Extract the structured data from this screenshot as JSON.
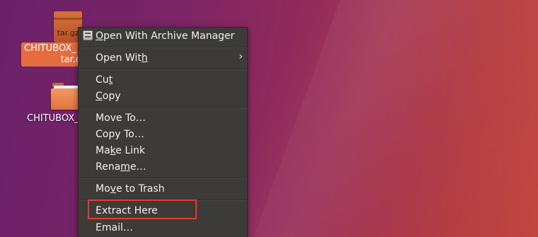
{
  "desktop": {
    "archive_icon": {
      "ext_label": "tar.gz",
      "label_line1": "CHITUBOX_",
      "label_line2": "tar.gz"
    },
    "folder_icon": {
      "label": "CHITUBOX_"
    }
  },
  "context_menu": {
    "items": [
      {
        "pre": "",
        "ul": "O",
        "post": "pen With Archive Manager"
      },
      {
        "pre": "Open Wit",
        "ul": "h",
        "post": ""
      },
      {
        "pre": "Cu",
        "ul": "t",
        "post": ""
      },
      {
        "pre": "",
        "ul": "C",
        "post": "opy"
      },
      {
        "pre": "Move To…",
        "ul": "",
        "post": ""
      },
      {
        "pre": "Copy To…",
        "ul": "",
        "post": ""
      },
      {
        "pre": "Ma",
        "ul": "k",
        "post": "e Link"
      },
      {
        "pre": "Rena",
        "ul": "m",
        "post": "e…"
      },
      {
        "pre": "Mo",
        "ul": "v",
        "post": "e to Trash"
      },
      {
        "pre": "Extract Here",
        "ul": "",
        "post": ""
      },
      {
        "pre": "Email…",
        "ul": "",
        "post": ""
      }
    ],
    "submenu_arrow": "›"
  },
  "colors": {
    "menu_bg": "#3c3b37",
    "selection_orange": "#e66c3f",
    "highlight_red": "#e53935"
  }
}
